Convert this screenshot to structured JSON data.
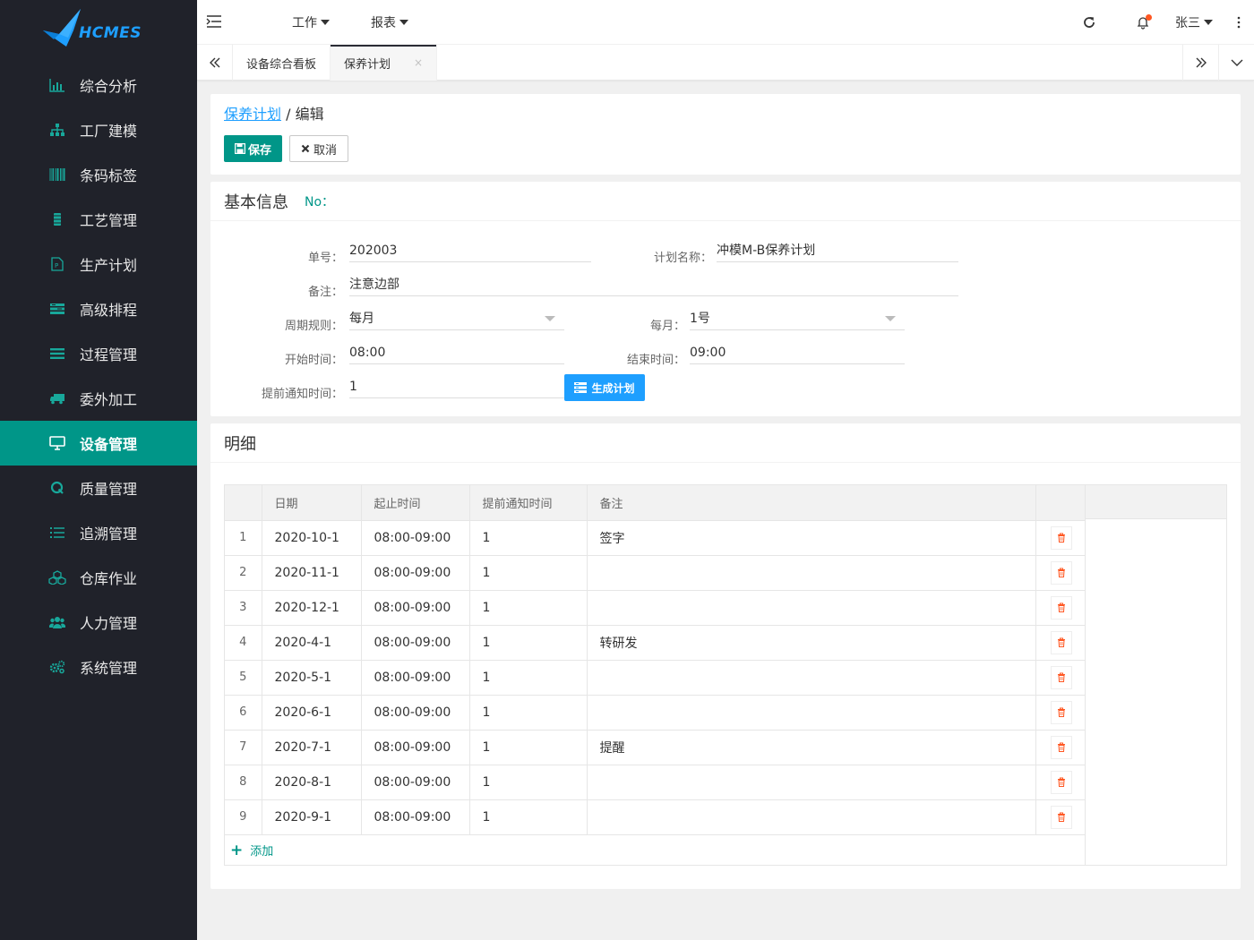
{
  "app": {
    "logo_text": "HCMES"
  },
  "sidebar": {
    "items": [
      {
        "label": "综合分析",
        "icon": "bar-chart-icon"
      },
      {
        "label": "工厂建模",
        "icon": "sitemap-icon"
      },
      {
        "label": "条码标签",
        "icon": "barcode-icon"
      },
      {
        "label": "工艺管理",
        "icon": "process-icon"
      },
      {
        "label": "生产计划",
        "icon": "document-icon"
      },
      {
        "label": "高级排程",
        "icon": "schedule-icon"
      },
      {
        "label": "过程管理",
        "icon": "list-icon"
      },
      {
        "label": "委外加工",
        "icon": "truck-icon"
      },
      {
        "label": "设备管理",
        "icon": "monitor-icon",
        "active": true
      },
      {
        "label": "质量管理",
        "icon": "quality-icon"
      },
      {
        "label": "追溯管理",
        "icon": "trace-list-icon"
      },
      {
        "label": "仓库作业",
        "icon": "cubes-icon"
      },
      {
        "label": "人力管理",
        "icon": "users-icon"
      },
      {
        "label": "系统管理",
        "icon": "gears-icon"
      }
    ]
  },
  "header": {
    "menu": [
      {
        "label": "工作"
      },
      {
        "label": "报表"
      }
    ],
    "user": "张三"
  },
  "tabs": [
    {
      "label": "设备综合看板",
      "active": false
    },
    {
      "label": "保养计划",
      "active": true,
      "close": "×"
    }
  ],
  "breadcrumb": {
    "link": "保养计划",
    "separator": " / ",
    "current": "编辑"
  },
  "actions": {
    "save": "保存",
    "cancel": "取消"
  },
  "basic": {
    "title": "基本信息",
    "no_label": "No：",
    "fields": {
      "order_no": {
        "label": "单号：",
        "value": "202003"
      },
      "plan_name": {
        "label": "计划名称：",
        "value": "冲模M-B保养计划"
      },
      "remark": {
        "label": "备注：",
        "value": "注意边部"
      },
      "cycle": {
        "label": "周期规则：",
        "value": "每月"
      },
      "monthly": {
        "label": "每月：",
        "value": "1号"
      },
      "start_time": {
        "label": "开始时间：",
        "value": "08:00"
      },
      "end_time": {
        "label": "结束时间：",
        "value": "09:00"
      },
      "notice": {
        "label": "提前通知时间：",
        "value": "1"
      }
    },
    "generate": "生成计划"
  },
  "detail": {
    "title": "明细",
    "columns": [
      "日期",
      "起止时间",
      "提前通知时间",
      "备注"
    ],
    "rows": [
      {
        "idx": "1",
        "date": "2020-10-1",
        "time": "08:00-09:00",
        "notice": "1",
        "remark": "签字"
      },
      {
        "idx": "2",
        "date": "2020-11-1",
        "time": "08:00-09:00",
        "notice": "1",
        "remark": ""
      },
      {
        "idx": "3",
        "date": "2020-12-1",
        "time": "08:00-09:00",
        "notice": "1",
        "remark": ""
      },
      {
        "idx": "4",
        "date": "2020-4-1",
        "time": "08:00-09:00",
        "notice": "1",
        "remark": "转研发"
      },
      {
        "idx": "5",
        "date": "2020-5-1",
        "time": "08:00-09:00",
        "notice": "1",
        "remark": ""
      },
      {
        "idx": "6",
        "date": "2020-6-1",
        "time": "08:00-09:00",
        "notice": "1",
        "remark": ""
      },
      {
        "idx": "7",
        "date": "2020-7-1",
        "time": "08:00-09:00",
        "notice": "1",
        "remark": "提醒"
      },
      {
        "idx": "8",
        "date": "2020-8-1",
        "time": "08:00-09:00",
        "notice": "1",
        "remark": ""
      },
      {
        "idx": "9",
        "date": "2020-9-1",
        "time": "08:00-09:00",
        "notice": "1",
        "remark": ""
      }
    ],
    "add": "添加"
  },
  "colors": {
    "accent": "#009688",
    "link": "#1e9fff",
    "sidebar": "#20222a",
    "danger": "#ff5722"
  }
}
